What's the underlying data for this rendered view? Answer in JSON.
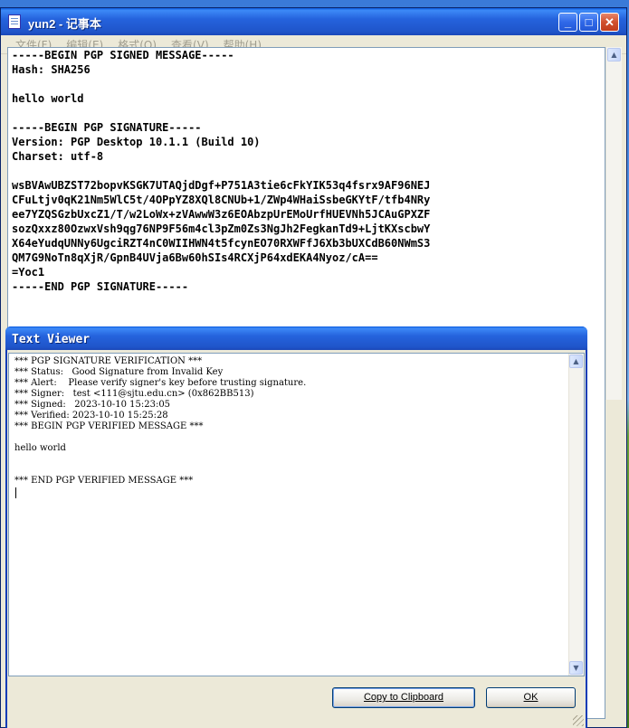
{
  "notepad": {
    "title": "yun2 - 记事本",
    "menu": [
      "文件(F)",
      "编辑(E)",
      "格式(O)",
      "查看(V)",
      "帮助(H)"
    ],
    "content": "-----BEGIN PGP SIGNED MESSAGE-----\nHash: SHA256\n\nhello world\n\n-----BEGIN PGP SIGNATURE-----\nVersion: PGP Desktop 10.1.1 (Build 10)\nCharset: utf-8\n\nwsBVAwUBZST72bopvKSGK7UTAQjdDgf+P751A3tie6cFkYIK53q4fsrx9AF96NEJ\nCFuLtjv0qK21Nm5WlC5t/4OPpYZ8XQl8CNUb+1/ZWp4WHaiSsbeGKYtF/tfb4NRy\nee7YZQSGzbUxcZ1/T/w2LoWx+zVAwwW3z6EOAbzpUrEMoUrfHUEVNh5JCAuGPXZF\nsozQxxz80OzwxVsh9qg76NP9F56m4cl3pZm0Zs3NgJh2FegkanTd9+LjtKXscbwY\nX64eYudqUNNy6UgciRZT4nC0WIIHWN4t5fcynEO70RXWFfJ6Xb3bUXCdB60NWmS3\nQM7G9NoTn8qXjR/GpnB4UVja6Bw60hSIs4RCXjP64xdEKA4Nyoz/cA==\n=Yoc1\n-----END PGP SIGNATURE-----"
  },
  "viewer": {
    "title": "Text Viewer",
    "content": "*** PGP SIGNATURE VERIFICATION ***\n*** Status:   Good Signature from Invalid Key\n*** Alert:    Please verify signer's key before trusting signature.\n*** Signer:   test <111@sjtu.edu.cn> (0x862BB513)\n*** Signed:   2023-10-10 15:23:05\n*** Verified: 2023-10-10 15:25:28\n*** BEGIN PGP VERIFIED MESSAGE ***\n\nhello world\n\n\n*** END PGP VERIFIED MESSAGE ***",
    "copy_label": "Copy to Clipboard",
    "ok_label": "OK"
  }
}
